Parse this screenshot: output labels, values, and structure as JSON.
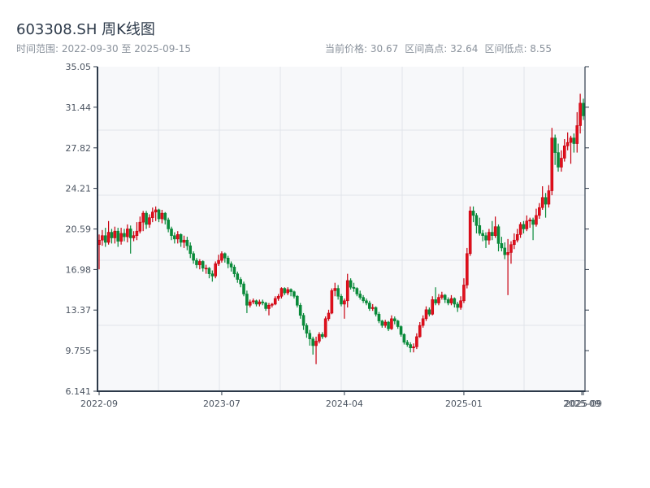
{
  "header": {
    "title": "603308.SH 周K线图",
    "range_text": "时间范围: 2022-09-30 至 2025-09-15",
    "current_price": "当前价格: 30.67",
    "range_high": "区间高点: 32.64",
    "range_low": "区间低点: 8.55"
  },
  "chart_data": {
    "type": "candlestick",
    "title": "603308.SH 周K线图",
    "ylim": [
      6.141,
      35.05
    ],
    "y_ticks": [
      "35.05",
      "31.44",
      "27.82",
      "24.21",
      "20.59",
      "16.98",
      "13.37",
      "9.755",
      "6.141"
    ],
    "x_ticks": [
      {
        "label": "2022-09",
        "index": 0
      },
      {
        "label": "2023-07",
        "index": 39
      },
      {
        "label": "2024-04",
        "index": 78
      },
      {
        "label": "2025-01",
        "index": 116
      },
      {
        "label": "2025-09",
        "index": 153.5
      },
      {
        "label": "2025-09",
        "index": 154
      }
    ],
    "grid": true,
    "colors": {
      "up": "#e0101c",
      "down": "#0a8a3a",
      "axis": "#2d3a4a",
      "grid": "#e1e4ea",
      "plot_bg": "#f7f8fa"
    },
    "candle_fields": [
      "open",
      "high",
      "low",
      "close"
    ],
    "candles": [
      [
        19.2,
        20.1,
        17.0,
        19.6
      ],
      [
        19.6,
        20.5,
        19.1,
        20.0
      ],
      [
        20.0,
        20.7,
        19.0,
        19.4
      ],
      [
        19.4,
        21.3,
        19.2,
        20.3
      ],
      [
        20.3,
        20.6,
        19.3,
        19.8
      ],
      [
        19.8,
        20.8,
        19.3,
        20.4
      ],
      [
        20.4,
        20.7,
        19.0,
        19.5
      ],
      [
        19.5,
        20.7,
        19.2,
        20.2
      ],
      [
        20.2,
        20.6,
        19.5,
        19.9
      ],
      [
        19.9,
        21.0,
        19.4,
        20.6
      ],
      [
        20.6,
        20.9,
        18.4,
        19.8
      ],
      [
        19.8,
        20.4,
        19.5,
        20.0
      ],
      [
        20.0,
        21.2,
        19.6,
        20.4
      ],
      [
        20.4,
        21.7,
        20.2,
        21.2
      ],
      [
        21.2,
        22.2,
        20.4,
        22.0
      ],
      [
        22.0,
        22.2,
        20.6,
        21.0
      ],
      [
        21.0,
        21.9,
        20.7,
        21.6
      ],
      [
        21.6,
        22.5,
        21.2,
        22.1
      ],
      [
        22.1,
        22.6,
        21.3,
        22.3
      ],
      [
        22.3,
        22.4,
        21.2,
        21.5
      ],
      [
        21.5,
        22.3,
        21.1,
        22.0
      ],
      [
        22.0,
        22.1,
        21.0,
        21.4
      ],
      [
        21.4,
        21.6,
        20.3,
        20.6
      ],
      [
        20.6,
        20.8,
        19.6,
        20.0
      ],
      [
        20.0,
        20.3,
        19.3,
        19.7
      ],
      [
        19.7,
        20.4,
        19.3,
        20.1
      ],
      [
        20.1,
        20.2,
        19.0,
        19.4
      ],
      [
        19.4,
        20.0,
        18.9,
        19.6
      ],
      [
        19.6,
        19.9,
        18.7,
        19.1
      ],
      [
        19.1,
        19.4,
        18.0,
        18.4
      ],
      [
        18.4,
        18.6,
        17.5,
        17.8
      ],
      [
        17.8,
        18.0,
        17.1,
        17.4
      ],
      [
        17.4,
        17.9,
        17.0,
        17.7
      ],
      [
        17.7,
        17.8,
        16.8,
        17.1
      ],
      [
        17.1,
        17.4,
        16.6,
        17.1
      ],
      [
        17.1,
        17.2,
        16.2,
        16.6
      ],
      [
        16.6,
        16.9,
        15.9,
        16.4
      ],
      [
        16.4,
        17.7,
        16.2,
        17.5
      ],
      [
        17.5,
        18.3,
        17.3,
        17.8
      ],
      [
        17.8,
        18.6,
        17.6,
        18.4
      ],
      [
        18.4,
        18.5,
        17.6,
        18.0
      ],
      [
        18.0,
        18.2,
        17.1,
        17.5
      ],
      [
        17.5,
        17.7,
        16.8,
        17.2
      ],
      [
        17.2,
        17.4,
        16.3,
        16.6
      ],
      [
        16.6,
        16.8,
        15.8,
        16.1
      ],
      [
        16.1,
        16.3,
        15.4,
        15.7
      ],
      [
        15.7,
        15.9,
        14.6,
        14.8
      ],
      [
        14.8,
        15.1,
        13.1,
        13.8
      ],
      [
        13.8,
        14.3,
        13.6,
        14.1
      ],
      [
        14.1,
        14.4,
        13.9,
        14.2
      ],
      [
        14.2,
        14.3,
        13.7,
        13.9
      ],
      [
        13.9,
        14.3,
        13.7,
        14.1
      ],
      [
        14.1,
        14.3,
        13.8,
        14.0
      ],
      [
        14.0,
        14.1,
        13.3,
        13.5
      ],
      [
        13.5,
        14.0,
        12.9,
        13.8
      ],
      [
        13.8,
        14.0,
        13.6,
        13.9
      ],
      [
        13.9,
        14.6,
        13.8,
        14.4
      ],
      [
        14.4,
        14.8,
        14.2,
        14.6
      ],
      [
        14.6,
        15.4,
        14.4,
        15.3
      ],
      [
        15.3,
        15.4,
        14.7,
        14.9
      ],
      [
        14.9,
        15.4,
        14.7,
        15.2
      ],
      [
        15.2,
        15.3,
        14.6,
        15.0
      ],
      [
        15.0,
        15.1,
        14.4,
        14.6
      ],
      [
        14.6,
        14.7,
        13.6,
        13.8
      ],
      [
        13.8,
        14.0,
        12.6,
        12.9
      ],
      [
        12.9,
        13.1,
        11.6,
        12.0
      ],
      [
        12.0,
        12.2,
        10.9,
        11.3
      ],
      [
        11.3,
        11.6,
        10.2,
        10.8
      ],
      [
        10.8,
        11.0,
        9.4,
        10.2
      ],
      [
        10.2,
        11.0,
        8.55,
        10.6
      ],
      [
        10.6,
        11.4,
        10.4,
        11.2
      ],
      [
        11.2,
        11.4,
        10.8,
        11.0
      ],
      [
        11.0,
        12.8,
        10.9,
        12.6
      ],
      [
        12.6,
        13.4,
        12.4,
        13.1
      ],
      [
        13.1,
        15.3,
        13.0,
        15.1
      ],
      [
        15.1,
        15.8,
        14.6,
        15.3
      ],
      [
        15.3,
        15.6,
        14.3,
        14.6
      ],
      [
        14.6,
        14.8,
        13.7,
        13.9
      ],
      [
        13.9,
        14.4,
        12.6,
        14.2
      ],
      [
        14.2,
        16.6,
        13.6,
        16.0
      ],
      [
        16.0,
        16.2,
        15.2,
        15.4
      ],
      [
        15.4,
        15.8,
        15.0,
        15.3
      ],
      [
        15.3,
        15.4,
        14.6,
        14.8
      ],
      [
        14.8,
        15.1,
        14.3,
        14.5
      ],
      [
        14.5,
        14.7,
        14.0,
        14.2
      ],
      [
        14.2,
        14.4,
        13.8,
        14.0
      ],
      [
        14.0,
        14.2,
        13.3,
        13.5
      ],
      [
        13.5,
        13.9,
        13.3,
        13.6
      ],
      [
        13.6,
        13.7,
        12.8,
        13.0
      ],
      [
        13.0,
        13.2,
        12.2,
        12.4
      ],
      [
        12.4,
        12.5,
        11.8,
        12.0
      ],
      [
        12.0,
        12.5,
        11.8,
        12.3
      ],
      [
        12.3,
        12.4,
        11.5,
        11.7
      ],
      [
        11.7,
        12.9,
        11.6,
        12.6
      ],
      [
        12.6,
        12.8,
        12.1,
        12.4
      ],
      [
        12.4,
        12.5,
        11.7,
        11.9
      ],
      [
        11.9,
        12.0,
        11.0,
        11.2
      ],
      [
        11.2,
        11.3,
        10.3,
        10.5
      ],
      [
        10.5,
        10.7,
        10.1,
        10.3
      ],
      [
        10.3,
        10.5,
        9.6,
        10.0
      ],
      [
        10.0,
        10.4,
        9.6,
        10.1
      ],
      [
        10.1,
        11.3,
        9.9,
        11.0
      ],
      [
        11.0,
        12.3,
        10.9,
        12.0
      ],
      [
        12.0,
        12.9,
        11.8,
        12.6
      ],
      [
        12.6,
        13.7,
        12.4,
        13.4
      ],
      [
        13.4,
        13.6,
        12.8,
        13.0
      ],
      [
        13.0,
        14.6,
        12.9,
        14.3
      ],
      [
        14.3,
        15.4,
        13.8,
        14.0
      ],
      [
        14.0,
        14.8,
        13.8,
        14.5
      ],
      [
        14.5,
        15.0,
        14.3,
        14.7
      ],
      [
        14.7,
        14.8,
        14.0,
        14.3
      ],
      [
        14.3,
        14.5,
        13.8,
        14.0
      ],
      [
        14.0,
        14.7,
        13.8,
        14.4
      ],
      [
        14.4,
        14.5,
        13.6,
        13.9
      ],
      [
        13.9,
        14.1,
        13.2,
        13.6
      ],
      [
        13.6,
        14.6,
        13.4,
        14.2
      ],
      [
        14.2,
        16.2,
        14.0,
        15.6
      ],
      [
        15.6,
        18.9,
        15.3,
        18.4
      ],
      [
        18.4,
        22.6,
        18.2,
        22.2
      ],
      [
        22.2,
        22.6,
        21.2,
        21.8
      ],
      [
        21.8,
        22.0,
        20.2,
        20.9
      ],
      [
        20.9,
        21.6,
        20.0,
        20.2
      ],
      [
        20.2,
        20.5,
        19.5,
        20.0
      ],
      [
        20.0,
        20.3,
        18.9,
        19.6
      ],
      [
        19.6,
        20.6,
        19.2,
        20.3
      ],
      [
        20.3,
        21.3,
        19.6,
        20.0
      ],
      [
        20.0,
        21.7,
        19.8,
        20.8
      ],
      [
        20.8,
        21.0,
        18.6,
        19.3
      ],
      [
        19.3,
        19.9,
        18.6,
        18.9
      ],
      [
        18.9,
        19.4,
        17.9,
        18.3
      ],
      [
        18.3,
        19.7,
        14.7,
        18.5
      ],
      [
        18.5,
        19.5,
        17.5,
        19.2
      ],
      [
        19.2,
        20.2,
        18.8,
        19.6
      ],
      [
        19.6,
        20.6,
        19.4,
        20.1
      ],
      [
        20.1,
        21.2,
        19.8,
        21.0
      ],
      [
        21.0,
        21.3,
        20.2,
        20.6
      ],
      [
        20.6,
        21.8,
        20.4,
        21.3
      ],
      [
        21.3,
        21.6,
        20.7,
        21.4
      ],
      [
        21.4,
        21.6,
        19.6,
        21.0
      ],
      [
        21.0,
        22.4,
        20.8,
        21.8
      ],
      [
        21.8,
        22.9,
        21.5,
        22.5
      ],
      [
        22.5,
        24.4,
        22.3,
        23.4
      ],
      [
        23.4,
        23.8,
        21.6,
        22.8
      ],
      [
        22.8,
        24.5,
        22.5,
        24.0
      ],
      [
        24.0,
        29.6,
        23.6,
        28.7
      ],
      [
        28.7,
        29.0,
        26.3,
        27.4
      ],
      [
        27.4,
        28.2,
        25.7,
        26.1
      ],
      [
        26.1,
        27.6,
        25.7,
        26.9
      ],
      [
        26.9,
        28.6,
        26.6,
        28.0
      ],
      [
        28.0,
        29.2,
        27.6,
        28.3
      ],
      [
        28.3,
        28.9,
        26.4,
        28.7
      ],
      [
        28.7,
        29.1,
        27.4,
        28.2
      ],
      [
        28.2,
        31.0,
        27.4,
        29.8
      ],
      [
        29.8,
        32.64,
        29.1,
        31.8
      ],
      [
        31.8,
        32.2,
        30.3,
        30.67
      ]
    ]
  }
}
